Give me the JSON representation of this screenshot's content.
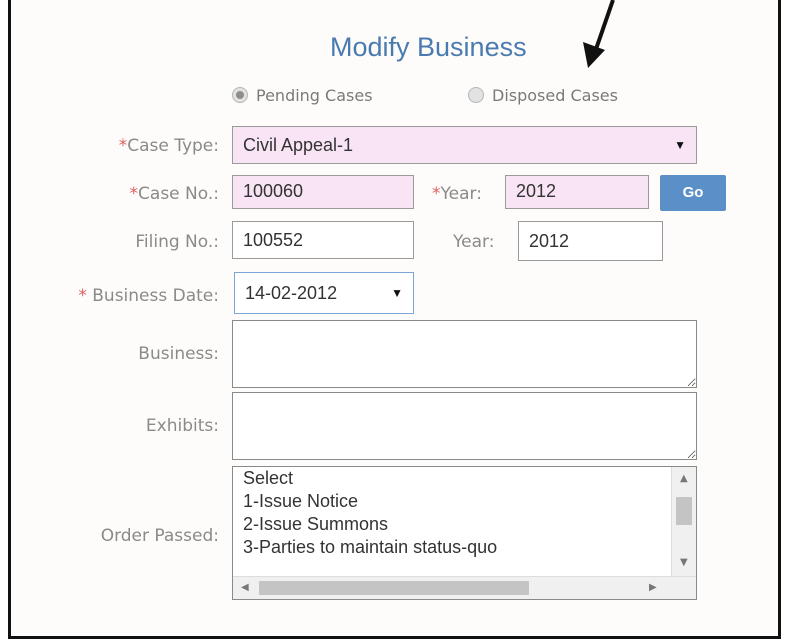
{
  "title": "Modify Business",
  "radios": [
    {
      "label": "Pending Cases",
      "checked": true
    },
    {
      "label": "Disposed Cases",
      "checked": false
    }
  ],
  "form": {
    "case_type_label": "Case Type:",
    "case_type_value": "Civil Appeal-1",
    "case_no_label": "Case No.:",
    "case_no_value": "100060",
    "year_label": "Year:",
    "year_value": "2012",
    "go_label": "Go",
    "filing_no_label": "Filing No.:",
    "filing_no_value": "100552",
    "filing_year_label": "Year:",
    "filing_year_value": "2012",
    "business_date_label": "Business Date:",
    "business_date_value": "14-02-2012",
    "business_label": "Business:",
    "exhibits_label": "Exhibits:",
    "order_passed_label": "Order Passed:",
    "order_options": [
      "Select",
      "1-Issue Notice",
      "2-Issue Summons",
      "3-Parties to maintain status-quo"
    ]
  },
  "colors": {
    "title": "#4a7bb0",
    "pink_field": "#f8e4f4",
    "go_button": "#5b8fc8",
    "required": "#e06060"
  },
  "icons": {
    "dropdown": "triangle-down",
    "annotation": "arrow"
  }
}
